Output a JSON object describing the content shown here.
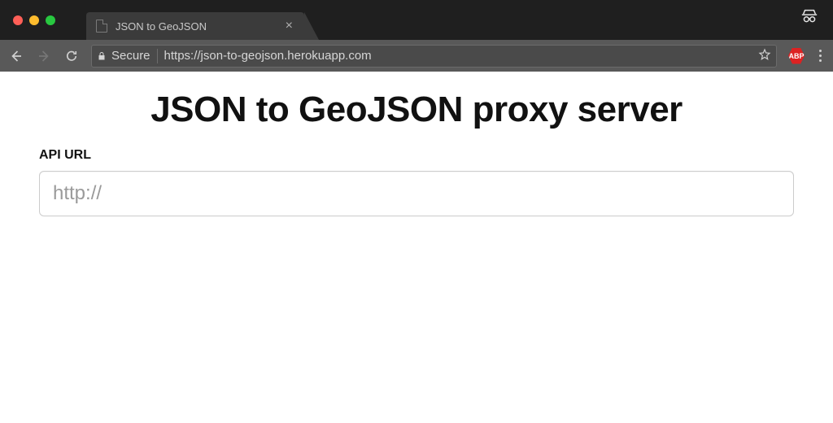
{
  "browser": {
    "tab": {
      "title": "JSON to GeoJSON"
    },
    "secure_label": "Secure",
    "url": "https://json-to-geojson.herokuapp.com",
    "abp_label": "ABP"
  },
  "page": {
    "heading": "JSON to GeoJSON proxy server",
    "api_label": "API URL",
    "api_placeholder": "http://",
    "api_value": ""
  }
}
